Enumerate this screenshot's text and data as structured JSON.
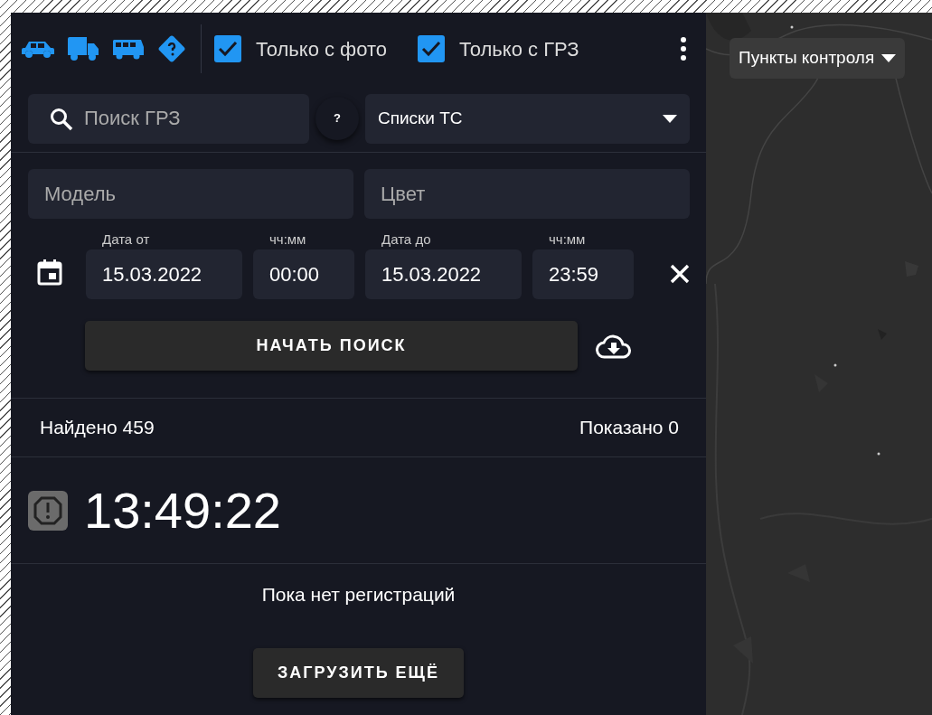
{
  "vehicle_types": [
    {
      "kind": "car"
    },
    {
      "kind": "truck"
    },
    {
      "kind": "bus"
    },
    {
      "kind": "unknown"
    }
  ],
  "checkboxes": [
    {
      "label": "Только с фото",
      "checked": true
    },
    {
      "label": "Только с ГРЗ",
      "checked": true
    }
  ],
  "search": {
    "placeholder": "Поиск ГРЗ"
  },
  "help_button": "?",
  "lists_dropdown": {
    "value": "Списки ТС"
  },
  "model": {
    "placeholder": "Модель"
  },
  "color": {
    "placeholder": "Цвет"
  },
  "date_fields": [
    {
      "label": "Дата от",
      "value": "15.03.2022",
      "kind": "date"
    },
    {
      "label": "чч:мм",
      "value": "00:00",
      "kind": "time"
    },
    {
      "label": "Дата до",
      "value": "15.03.2022",
      "kind": "date"
    },
    {
      "label": "чч:мм",
      "value": "23:59",
      "kind": "time"
    }
  ],
  "start_button": "НАЧАТЬ ПОИСК",
  "found": "Найдено 459",
  "shown": "Показано 0",
  "clock": "13:49:22",
  "empty_message": "Пока нет регистраций",
  "load_more_button": "ЗАГРУЗИТЬ ЕЩЁ",
  "map": {
    "kind": "picture",
    "layer_dropdown": "Пункты контроля"
  }
}
